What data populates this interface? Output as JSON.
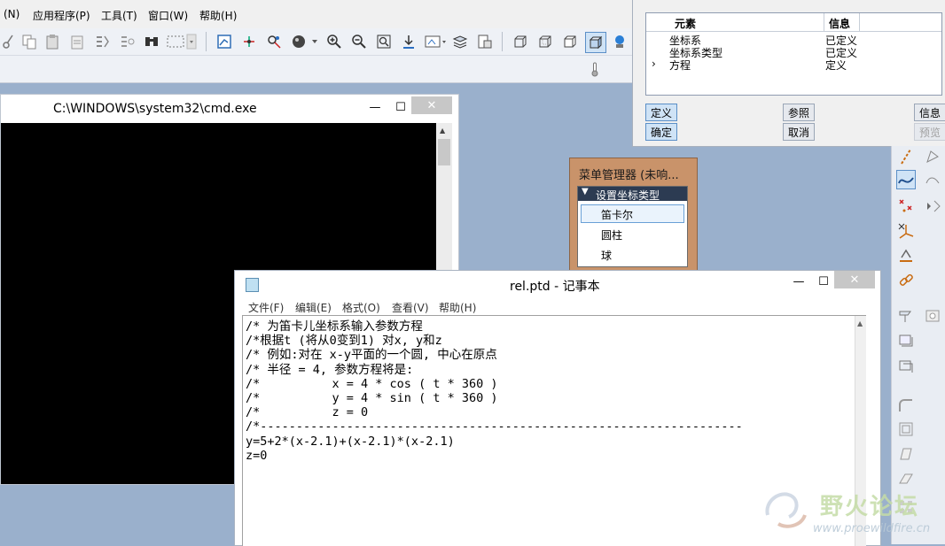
{
  "menubar": {
    "items": [
      "(N)",
      "应用程序(P)",
      "工具(T)",
      "窗口(W)",
      "帮助(H)"
    ]
  },
  "cmd_window": {
    "title": "C:\\WINDOWS\\system32\\cmd.exe",
    "minimize": "—",
    "maximize": "☐",
    "close": "✕"
  },
  "element_dialog": {
    "col_element": "元素",
    "col_info": "信息",
    "rows": [
      {
        "marker": "",
        "element": "坐标系",
        "info": "已定义"
      },
      {
        "marker": "",
        "element": "坐标系类型",
        "info": "已定义"
      },
      {
        "marker": "›",
        "element": "方程",
        "info": "定义"
      }
    ],
    "buttons": {
      "define": "定义",
      "reference": "参照",
      "info": "信息",
      "ok": "确定",
      "cancel": "取消",
      "preview": "预览"
    }
  },
  "menu_manager": {
    "title": "菜单管理器 (未响...",
    "header": "设置坐标类型",
    "items": [
      "笛卡尔",
      "圆柱",
      "球"
    ],
    "selected": "笛卡尔"
  },
  "notepad": {
    "title": "rel.ptd - 记事本",
    "menu": [
      "文件(F)",
      "编辑(E)",
      "格式(O)",
      "查看(V)",
      "帮助(H)"
    ],
    "lines": [
      "/* 为笛卡儿坐标系输入参数方程",
      "/*根据t (将从0变到1) 对x, y和z",
      "/* 例如:对在 x-y平面的一个圆, 中心在原点",
      "/* 半径 = 4, 参数方程将是:",
      "/*          x = 4 * cos ( t * 360 )",
      "/*          y = 4 * sin ( t * 360 )",
      "/*          z = 0",
      "/*-------------------------------------------------------------------",
      "y=5+2*(x-2.1)+(x-2.1)*(x-2.1)",
      "z=0"
    ]
  },
  "watermark": {
    "text": "野火论坛",
    "url": "www.proewildfire.cn"
  },
  "colors": {
    "desktop": "#9ab0cc",
    "menu_manager_bg": "#c9936a",
    "menu_manager_header": "#2c3b52",
    "selected_button": "#cfe3f6"
  }
}
